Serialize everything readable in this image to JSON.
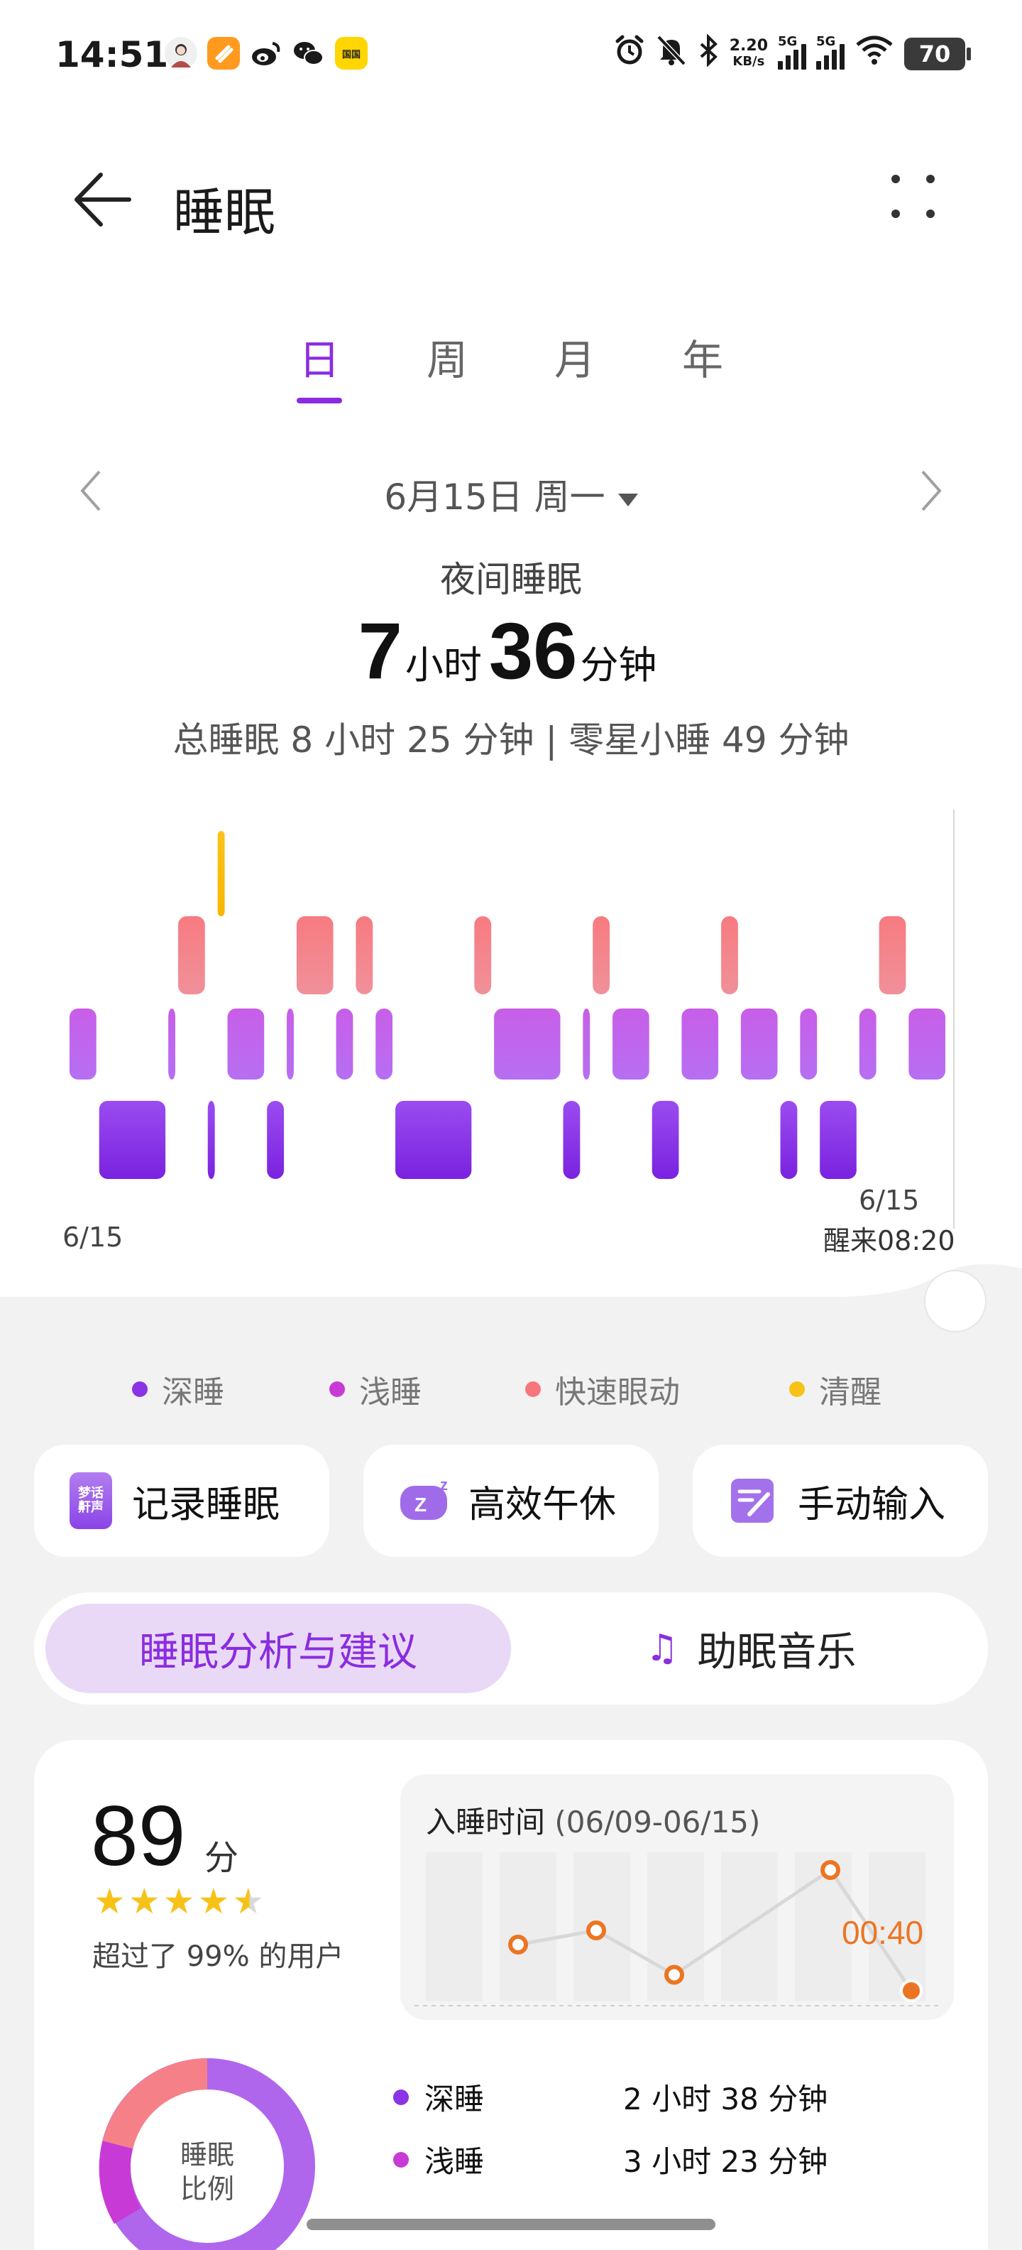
{
  "status": {
    "time": "14:51",
    "net_speed_value": "2.20",
    "net_speed_unit": "KB/s",
    "sim1": "5G",
    "sim2": "5G",
    "battery": "70",
    "app_icons": [
      "avatar-app-icon",
      "orange-app-icon",
      "weibo-icon",
      "wechat-icon",
      "yellow-app-icon"
    ],
    "yellow_app_text": "国国"
  },
  "header": {
    "title": "睡眠"
  },
  "tabs": [
    {
      "label": "日",
      "active": true
    },
    {
      "label": "周",
      "active": false
    },
    {
      "label": "月",
      "active": false
    },
    {
      "label": "年",
      "active": false
    }
  ],
  "date_nav": {
    "label": "6月15日 周一"
  },
  "summary": {
    "type_label": "夜间睡眠",
    "hours": "7",
    "hours_unit": "小时",
    "minutes": "36",
    "minutes_unit": "分钟",
    "total_line": "总睡眠 8 小时 25 分钟 | 零星小睡 49 分钟"
  },
  "chart_data": {
    "type": "timeline",
    "levels": [
      "清醒",
      "快速眼动",
      "浅睡",
      "深睡"
    ],
    "colors": {
      "deep": "#8a34e6",
      "light": "#c46bf0",
      "rem": "#f7767b",
      "awake": "#f7c218"
    },
    "start_date": "6/15",
    "end_date": "6/15",
    "wake_label": "醒来08:20",
    "segments": [
      {
        "stage": "浅睡",
        "units": 3
      },
      {
        "stage": "深睡",
        "units": 7
      },
      {
        "stage": "浅睡",
        "units": 1
      },
      {
        "stage": "快速眼动",
        "units": 3
      },
      {
        "stage": "深睡",
        "units": 1
      },
      {
        "stage": "清醒",
        "units": 1
      },
      {
        "stage": "浅睡",
        "units": 4
      },
      {
        "stage": "深睡",
        "units": 2
      },
      {
        "stage": "浅睡",
        "units": 1
      },
      {
        "stage": "快速眼动",
        "units": 4
      },
      {
        "stage": "浅睡",
        "units": 2
      },
      {
        "stage": "快速眼动",
        "units": 2
      },
      {
        "stage": "浅睡",
        "units": 2
      },
      {
        "stage": "深睡",
        "units": 8
      },
      {
        "stage": "快速眼动",
        "units": 2
      },
      {
        "stage": "浅睡",
        "units": 7
      },
      {
        "stage": "深睡",
        "units": 2
      },
      {
        "stage": "浅睡",
        "units": 1
      },
      {
        "stage": "快速眼动",
        "units": 2
      },
      {
        "stage": "浅睡",
        "units": 4
      },
      {
        "stage": "深睡",
        "units": 3
      },
      {
        "stage": "浅睡",
        "units": 4
      },
      {
        "stage": "快速眼动",
        "units": 2
      },
      {
        "stage": "浅睡",
        "units": 4
      },
      {
        "stage": "深睡",
        "units": 2
      },
      {
        "stage": "浅睡",
        "units": 2
      },
      {
        "stage": "深睡",
        "units": 4
      },
      {
        "stage": "浅睡",
        "units": 2
      },
      {
        "stage": "快速眼动",
        "units": 3
      },
      {
        "stage": "浅睡",
        "units": 4
      }
    ]
  },
  "legend": [
    {
      "label": "深睡",
      "color": "#8a34e6"
    },
    {
      "label": "浅睡",
      "color": "#c83ad6"
    },
    {
      "label": "快速眼动",
      "color": "#f7767b"
    },
    {
      "label": "清醒",
      "color": "#f7c218"
    }
  ],
  "quick_actions": [
    {
      "label": "记录睡眠",
      "icon": "dream-talk-icon",
      "icon_text": "梦话鼾声"
    },
    {
      "label": "高效午休",
      "icon": "pillow-zz-icon"
    },
    {
      "label": "手动输入",
      "icon": "edit-note-icon"
    }
  ],
  "segmented": {
    "active": "睡眠分析与建议",
    "other": "助眠音乐"
  },
  "score": {
    "value": "89",
    "unit": "分",
    "stars": 4.5,
    "percent_text": "超过了 99% 的用户"
  },
  "bedtime_chart": {
    "title": "入睡时间",
    "range": "(06/09-06/15)",
    "current_label": "00:40",
    "points_relative": [
      0.36,
      0.44,
      0.19,
      0.78,
      0.1
    ]
  },
  "ratio": {
    "label_line1": "睡眠",
    "label_line2": "比例",
    "items": [
      {
        "label": "深睡",
        "value": "2 小时 38 分钟",
        "color": "#8a34e6"
      },
      {
        "label": "浅睡",
        "value": "3 小时 23 分钟",
        "color": "#c83ad6"
      }
    ]
  }
}
